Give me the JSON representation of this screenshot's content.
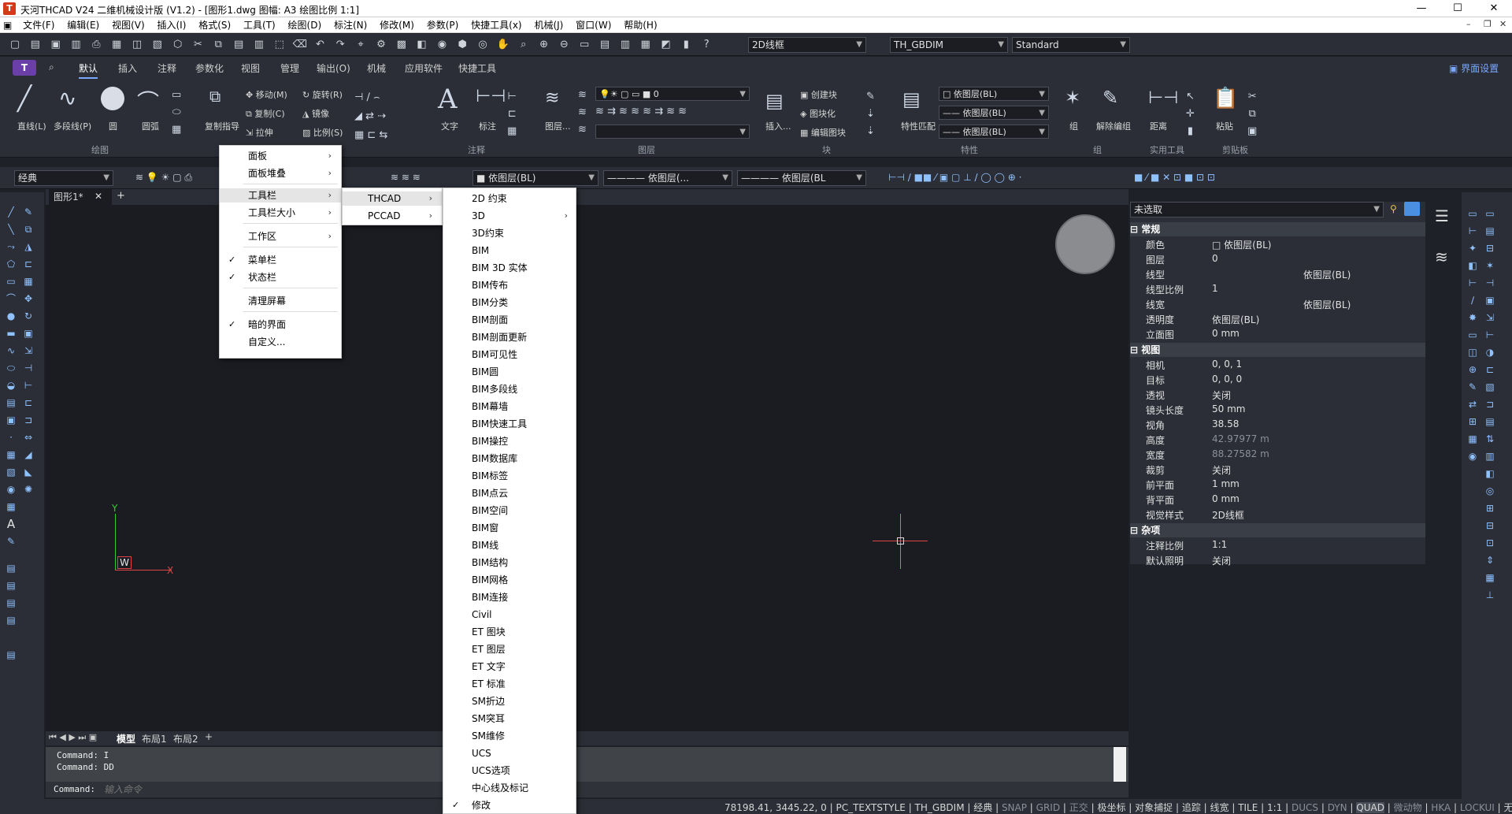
{
  "window": {
    "title": "天河THCAD V24 二维机械设计版 (V1.2) - [图形1.dwg 图幅: A3 绘图比例 1:1]",
    "logo": "T"
  },
  "menus": [
    "文件(F)",
    "编辑(E)",
    "视图(V)",
    "插入(I)",
    "格式(S)",
    "工具(T)",
    "绘图(D)",
    "标注(N)",
    "修改(M)",
    "参数(P)",
    "快捷工具(x)",
    "机械(J)",
    "窗口(W)",
    "帮助(H)"
  ],
  "qat": {
    "visual_style": "2D线框",
    "dimstyle": "TH_GBDIM",
    "textstyle": "Standard"
  },
  "ribbon_tabs": [
    "默认",
    "插入",
    "注释",
    "参数化",
    "视图",
    "管理",
    "输出(O)",
    "机械",
    "应用软件",
    "快捷工具"
  ],
  "ui_settings": "界面设置",
  "ribbon": {
    "draw": [
      "直线(L)",
      "多段线(P)",
      "圆",
      "圆弧"
    ],
    "modify": [
      "移动(M)",
      "旋转(R)",
      "复制(C)",
      "镜像",
      "拉伸",
      "比例(S)",
      "复制指导"
    ],
    "text": "文字",
    "dim": "标注",
    "layer_btn": "图层...",
    "layer_value": "0",
    "insert": "插入...",
    "block": [
      "创建块",
      "图块化",
      "编辑图块"
    ],
    "match": "特性匹配",
    "prop_combos": [
      "依图层(BL)",
      "依图层(BL)",
      "依图层(BL)"
    ],
    "group": "组",
    "ungroup": "解除编组",
    "distance": "距离",
    "paste": "粘贴",
    "panels": [
      "绘图",
      "修改",
      "注释",
      "图层",
      "块",
      "特性",
      "组",
      "实用工具",
      "剪贴板"
    ]
  },
  "props_row": {
    "workspace": "经典",
    "color": "依图层(BL)",
    "linetype": "依图层(...",
    "lineweight": "依图层(BL"
  },
  "doc_tab": "图形1*",
  "ctx_main": [
    {
      "label": "面板",
      "sub": true
    },
    {
      "label": "面板堆叠",
      "sub": true
    },
    {
      "sep": true
    },
    {
      "label": "工具栏",
      "sub": true,
      "hl": true
    },
    {
      "label": "工具栏大小",
      "sub": true
    },
    {
      "sep": true
    },
    {
      "label": "工作区",
      "sub": true
    },
    {
      "sep": true
    },
    {
      "label": "菜单栏",
      "check": true
    },
    {
      "label": "状态栏",
      "check": true
    },
    {
      "sep": true
    },
    {
      "label": "清理屏幕"
    },
    {
      "sep": true
    },
    {
      "label": "暗的界面",
      "check": true
    },
    {
      "label": "自定义..."
    }
  ],
  "ctx_sub": [
    {
      "label": "THCAD",
      "sub": true,
      "hl": true
    },
    {
      "label": "PCCAD",
      "sub": true
    }
  ],
  "ctx_list": [
    "2D 约束",
    "3D",
    "3D约束",
    "BIM",
    "BIM 3D 实体",
    "BIM传布",
    "BIM分类",
    "BIM剖面",
    "BIM剖面更新",
    "BIM可见性",
    "BIM圆",
    "BIM多段线",
    "BIM幕墙",
    "BIM快速工具",
    "BIM操控",
    "BIM数据库",
    "BIM标签",
    "BIM点云",
    "BIM空间",
    "BIM窗",
    "BIM线",
    "BIM结构",
    "BIM网格",
    "BIM连接",
    "Civil",
    "ET 图块",
    "ET 图层",
    "ET 文字",
    "ET 标准",
    "SM折边",
    "SM突耳",
    "SM维修",
    "UCS",
    "UCS选项",
    "中心线及标记",
    "修改"
  ],
  "properties": {
    "selection": "未选取",
    "sections": [
      {
        "name": "常规",
        "rows": [
          [
            "颜色",
            "依图层(BL)"
          ],
          [
            "图层",
            "0"
          ],
          [
            "线型",
            "依图层(BL)"
          ],
          [
            "线型比例",
            "1"
          ],
          [
            "线宽",
            "依图层(BL)"
          ],
          [
            "透明度",
            "依图层(BL)"
          ],
          [
            "立面图",
            "0 mm"
          ]
        ]
      },
      {
        "name": "视图",
        "rows": [
          [
            "相机",
            "0, 0, 1"
          ],
          [
            "目标",
            "0, 0, 0"
          ],
          [
            "透视",
            "关闭"
          ],
          [
            "镜头长度",
            "50 mm"
          ],
          [
            "视角",
            "38.58"
          ],
          [
            "高度",
            "42.97977 m"
          ],
          [
            "宽度",
            "88.27582 m"
          ],
          [
            "裁剪",
            "关闭"
          ],
          [
            "前平面",
            "1 mm"
          ],
          [
            "背平面",
            "0 mm"
          ],
          [
            "视觉样式",
            "2D线框"
          ]
        ]
      },
      {
        "name": "杂项",
        "rows": [
          [
            "注释比例",
            "1:1"
          ],
          [
            "默认照明",
            "关闭"
          ]
        ]
      }
    ]
  },
  "layout_tabs": [
    "模型",
    "布局1",
    "布局2"
  ],
  "command": {
    "history": [
      "Command: I",
      "Command: DD"
    ],
    "prompt": "Command:",
    "placeholder": "输入命令"
  },
  "status": {
    "coords": "78198.41, 3445.22, 0",
    "items": [
      "PC_TEXTSTYLE",
      "TH_GBDIM",
      "经典",
      "SNAP",
      "GRID",
      "正交",
      "极坐标",
      "对象捕捉",
      "追踪",
      "线宽",
      "TILE",
      "1:1",
      "DUCS",
      "DYN",
      "QUAD",
      "微动物",
      "HKA",
      "LOCKUI",
      "无"
    ]
  },
  "ucs": {
    "x": "X",
    "y": "Y",
    "w": "W"
  },
  "colors": {
    "accent": "#7aa8ff",
    "canvas": "#1a1c22",
    "panel": "#2b2e36"
  }
}
